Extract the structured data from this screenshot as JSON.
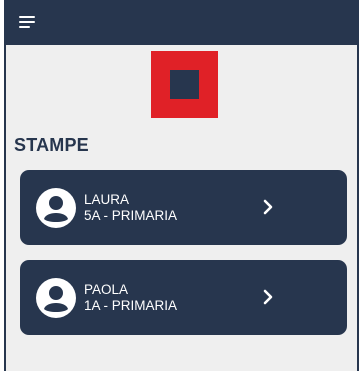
{
  "header": {
    "menu_icon": "hamburger-menu-icon"
  },
  "logo": {
    "outer_color": "#e02127",
    "inner_color": "#27364e"
  },
  "section": {
    "title": "STAMPE"
  },
  "students": [
    {
      "name": "LAURA",
      "class": "5A - PRIMARIA",
      "icon": "user-avatar-icon",
      "action_icon": "chevron-right-icon"
    },
    {
      "name": "PAOLA",
      "class": "1A - PRIMARIA",
      "icon": "user-avatar-icon",
      "action_icon": "chevron-right-icon"
    }
  ],
  "colors": {
    "primary": "#27364e",
    "accent": "#e02127",
    "background": "#efefef"
  }
}
